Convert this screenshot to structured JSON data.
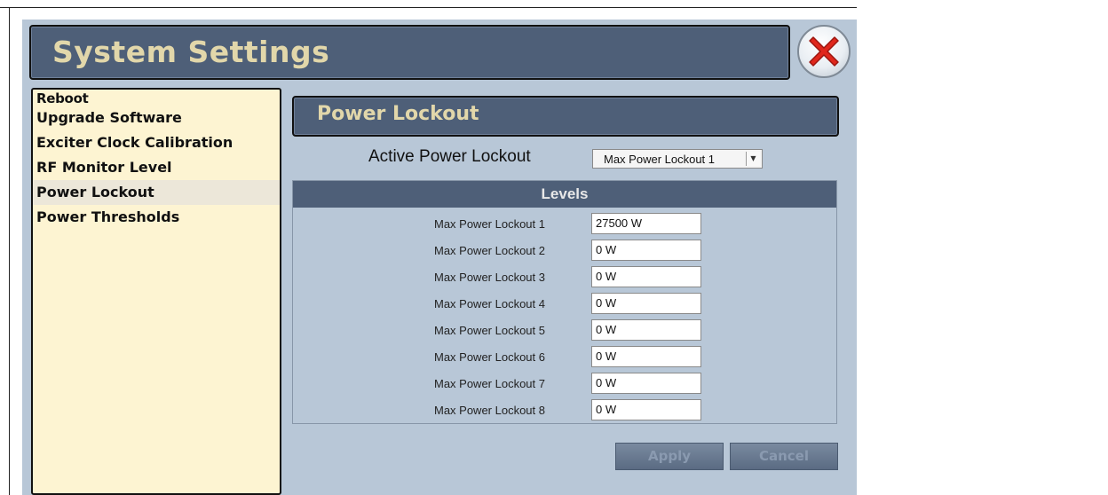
{
  "window": {
    "title": "System Settings"
  },
  "sidebar": {
    "items": [
      {
        "label": "Reboot",
        "selected": false
      },
      {
        "label": "Upgrade Software",
        "selected": false
      },
      {
        "label": "Exciter Clock Calibration",
        "selected": false
      },
      {
        "label": "RF Monitor Level",
        "selected": false
      },
      {
        "label": "Power Lockout",
        "selected": true
      },
      {
        "label": "Power Thresholds",
        "selected": false
      }
    ]
  },
  "main": {
    "section_title": "Power Lockout",
    "active_lockout": {
      "label": "Active Power Lockout",
      "selected": "Max Power Lockout 1"
    },
    "levels": {
      "header": "Levels",
      "rows": [
        {
          "label": "Max Power Lockout 1",
          "value": "27500 W"
        },
        {
          "label": "Max Power Lockout 2",
          "value": "0 W"
        },
        {
          "label": "Max Power Lockout 3",
          "value": "0 W"
        },
        {
          "label": "Max Power Lockout 4",
          "value": "0 W"
        },
        {
          "label": "Max Power Lockout 5",
          "value": "0 W"
        },
        {
          "label": "Max Power Lockout 6",
          "value": "0 W"
        },
        {
          "label": "Max Power Lockout 7",
          "value": "0 W"
        },
        {
          "label": "Max Power Lockout 8",
          "value": "0 W"
        }
      ]
    },
    "buttons": {
      "apply": "Apply",
      "cancel": "Cancel"
    }
  },
  "colors": {
    "window_bg": "#b8c7d7",
    "header_bg": "#4e5f78",
    "header_text": "#e2d7aa",
    "sidebar_bg": "#fdf4d2",
    "close_red": "#e0271c"
  },
  "icons": {
    "close": "close-x-icon",
    "dropdown": "chevron-down-icon"
  }
}
